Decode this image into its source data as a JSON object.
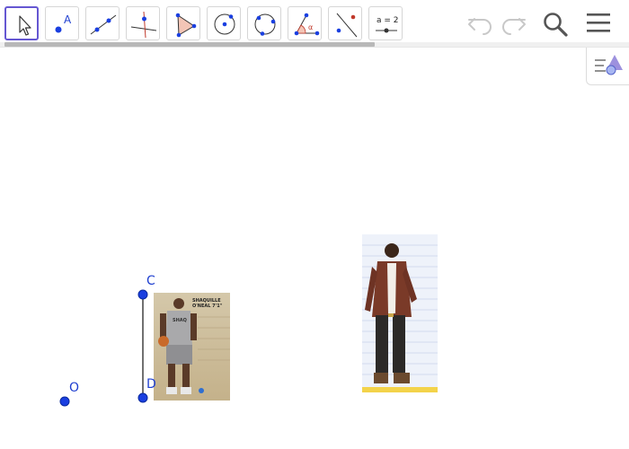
{
  "toolbar": {
    "tools": [
      {
        "name": "move-tool",
        "selected": true
      },
      {
        "name": "point-tool",
        "icon_letter": "A"
      },
      {
        "name": "line-tool"
      },
      {
        "name": "perpendicular-line-tool"
      },
      {
        "name": "polygon-tool"
      },
      {
        "name": "circle-with-center-tool"
      },
      {
        "name": "circle-through-three-points-tool"
      },
      {
        "name": "angle-tool",
        "icon_letter": "α"
      },
      {
        "name": "reflect-about-line-tool"
      },
      {
        "name": "slider-tool",
        "icon_text": "a = 2"
      }
    ],
    "undo_icon": "undo-icon",
    "redo_icon": "redo-icon",
    "search_icon": "search-icon",
    "menu_icon": "hamburger-menu-icon"
  },
  "side_panel": {
    "icon": "algebra-view-toggle-icon"
  },
  "canvas": {
    "points": [
      {
        "label": "C"
      },
      {
        "label": "D"
      },
      {
        "label": "O"
      }
    ],
    "images": [
      {
        "name": "shaq-cutout-image",
        "caption_lines": [
          "SHAQUILLE",
          "O'NEAL  7'1\""
        ],
        "jersey": "SHAQ"
      },
      {
        "name": "man-in-brown-jacket-image"
      }
    ]
  },
  "colors": {
    "accent": "#6557d2",
    "point_fill": "#1a3fe0",
    "label": "#1f3fd0",
    "toolbar_border": "#d6d6d6"
  }
}
